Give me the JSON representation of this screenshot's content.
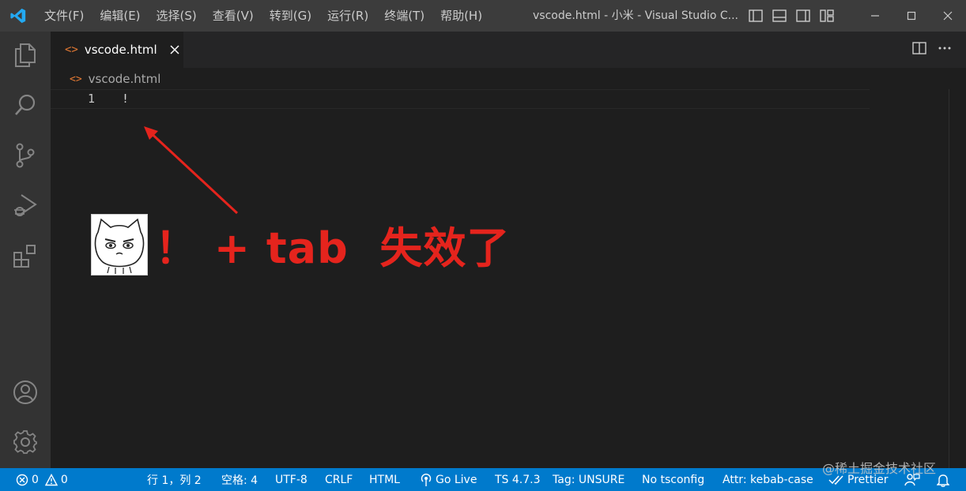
{
  "titlebar": {
    "menus": [
      "文件(F)",
      "编辑(E)",
      "选择(S)",
      "查看(V)",
      "转到(G)",
      "运行(R)",
      "终端(T)",
      "帮助(H)"
    ],
    "window_title": "vscode.html - 小米 - Visual Studio C..."
  },
  "tabs": [
    {
      "label": "vscode.html",
      "icon": "html-file-icon"
    }
  ],
  "breadcrumb": {
    "file": "vscode.html"
  },
  "editor": {
    "lines": [
      {
        "number": "1",
        "text": "!"
      }
    ]
  },
  "annotation": {
    "text": "！ + tab  失效了"
  },
  "statusbar": {
    "errors": "0",
    "warnings": "0",
    "position": "行 1，列 2",
    "spaces": "空格: 4",
    "encoding": "UTF-8",
    "eol": "CRLF",
    "language": "HTML",
    "go_live": "Go Live",
    "ts_version": "TS 4.7.3",
    "tag": "Tag: UNSURE",
    "tsconfig": "No tsconfig",
    "attr": "Attr: kebab-case",
    "prettier": "Prettier"
  },
  "watermark": "@稀土掘金技术社区",
  "colors": {
    "accent": "#007acc",
    "titlebar": "#3c3c3c",
    "activitybar": "#333333",
    "editor_bg": "#1e1e1e",
    "annotation_red": "#e5241d",
    "html_icon": "#e37933"
  }
}
